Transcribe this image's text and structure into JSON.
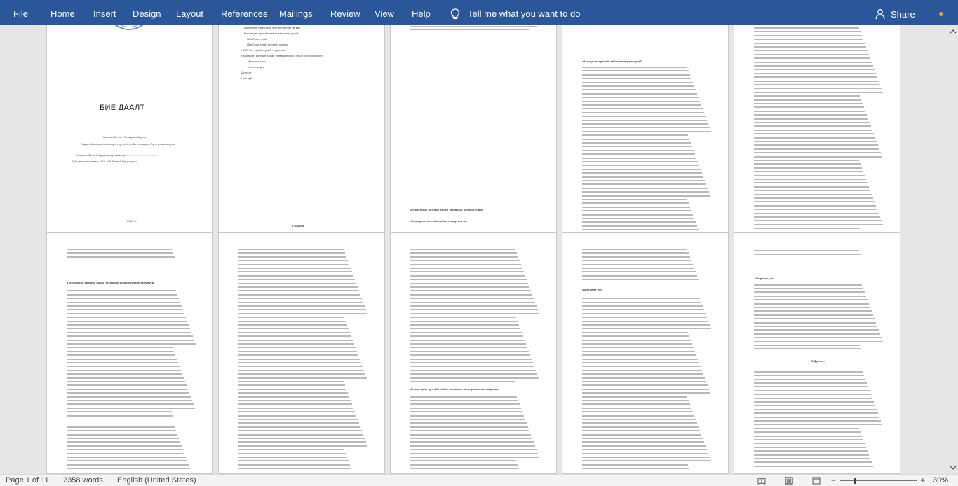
{
  "ribbon": {
    "tabs": [
      "File",
      "Home",
      "Insert",
      "Design",
      "Layout",
      "References",
      "Mailings",
      "Review",
      "View",
      "Help"
    ],
    "tell_me": "Tell me what you want to do",
    "share": "Share"
  },
  "document": {
    "title_page": {
      "title": "БИЕ ДААЛТ",
      "lines": [
        "Хичээлийн нэр: Татварын бүртгэл",
        "Сэдэв: Импортын нэмэгдсэн өртгийн албан татварын бүртгэлийн онцлог",
        "Хянасан багш: Б.Цэрэнханд /магистр/ ........................................",
        "Гүйцэтгэсэн оюутан: НББ-348 бүлэг Б.Цэцэгсүрэн..................................."
      ],
      "year": "2020 он"
    },
    "toc": {
      "items": [
        "Импортын нэмэгдсэн өртгийн албан татвар",
        "Нэмэгдсэн өртгийн албан татварын тухай",
        "НӨАТ-ын тухай",
        "НӨАТ-ын тухай хуулийн зарчим",
        "НӨАТ-ын тухай хуулийн хэрэгжилт",
        "Нэмэгдсэн өртгийн албан татварын хоног ульгэ нэр холбогдол",
        "Австрали улс",
        "Норвеги улс",
        "Дүгнэлт",
        "Ном зүй"
      ]
    },
    "headings": {
      "intro": "1.Оршил",
      "section2": "2.Нэмэгдсэн өртгийн албан татварын онолын үндэс",
      "section2_sub": "•Нэмэгдсэн өртгийн албан татвар гэж юу",
      "section_vat": "•Нэмэгдсэн өртгийн албан татварын тухай",
      "section3": "3.Нэмэгдсэн өртгийн албан татварын тухай хуулийн зарчмууд",
      "section4": "4.Нэмэгдсэн өртгийн албан татварын олон улсын чиг хандлага",
      "australia": "•Австрали улс",
      "norway": "•Норвеги улс",
      "conclusion": "5.Дүгнэлт"
    }
  },
  "status": {
    "page": "Page 1 of 11",
    "words": "2358 words",
    "language": "English (United States)",
    "zoom": "30%"
  }
}
